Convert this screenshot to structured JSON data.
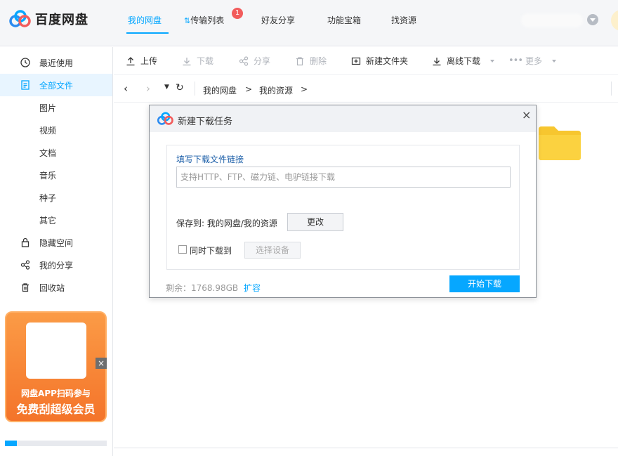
{
  "app": {
    "title": "百度网盘"
  },
  "nav": {
    "my_disk": "我的网盘",
    "transfer": "传输列表",
    "transfer_badge": "1",
    "share": "好友分享",
    "tools": "功能宝箱",
    "find": "找资源"
  },
  "sidebar": {
    "items": [
      {
        "label": "最近使用",
        "icon": "clock-icon"
      },
      {
        "label": "全部文件",
        "icon": "document-icon",
        "active": true
      },
      {
        "label": "图片"
      },
      {
        "label": "视频"
      },
      {
        "label": "文档"
      },
      {
        "label": "音乐"
      },
      {
        "label": "种子"
      },
      {
        "label": "其它"
      },
      {
        "label": "隐藏空间",
        "icon": "lock-icon"
      },
      {
        "label": "我的分享",
        "icon": "share-icon"
      },
      {
        "label": "回收站",
        "icon": "trash-icon"
      }
    ],
    "promo": {
      "line1": "网盘APP扫码参与",
      "line2": "免费刮超级会员",
      "close": "×"
    },
    "quota_fraction": 0.12
  },
  "toolbar": {
    "upload": "上传",
    "download": "下载",
    "share": "分享",
    "delete": "删除",
    "new_folder": "新建文件夹",
    "offline_download": "离线下载",
    "more": "更多"
  },
  "breadcrumb": {
    "root": "我的网盘",
    "current": "我的资源",
    "sep": ">"
  },
  "dialog": {
    "title": "新建下载任务",
    "close": "×",
    "link_label": "填写下载文件链接",
    "link_placeholder": "支持HTTP、FTP、磁力链、电驴链接下载",
    "save_to": "保存到: 我的网盘/我的资源",
    "change_button": "更改",
    "sync_label": "同时下载到",
    "select_device": "选择设备",
    "remaining": "剩余：1768.98GB",
    "expand": "扩容",
    "start_button": "开始下载"
  },
  "colors": {
    "accent": "#06a7ff",
    "badge": "#f25c5c",
    "promo": "#f4742a",
    "folder": "#f7c62f"
  }
}
